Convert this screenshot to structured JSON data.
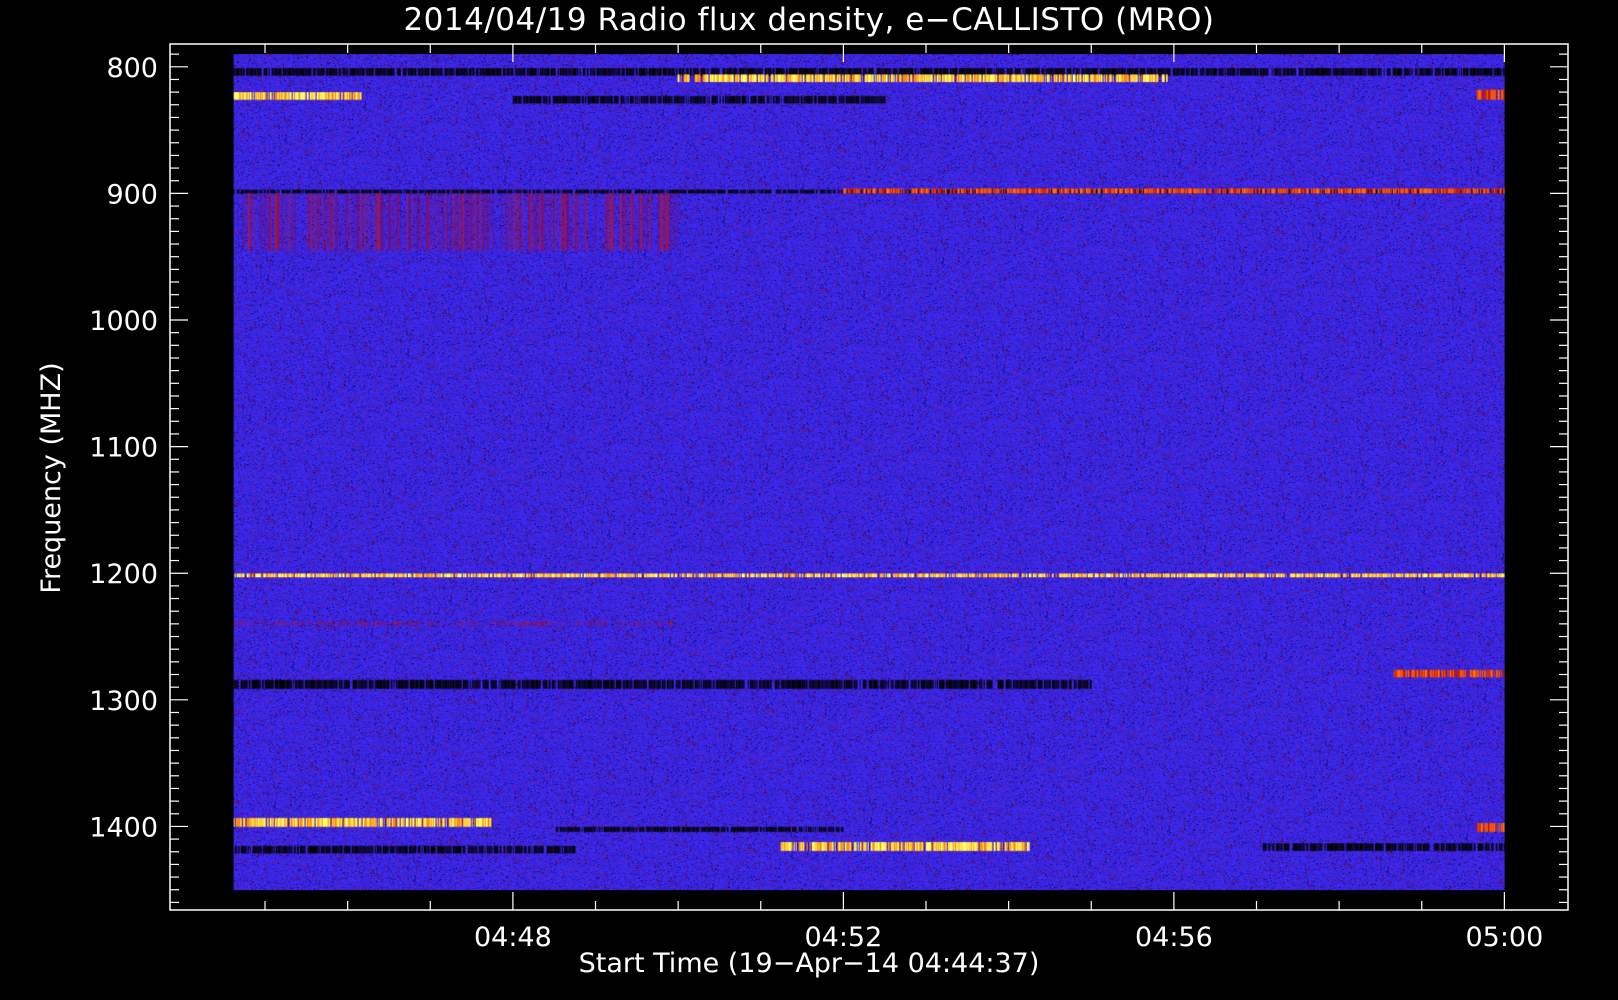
{
  "chart_data": {
    "type": "heatmap",
    "title": "2014/04/19  Radio flux density, e−CALLISTO (MRO)",
    "xlabel": "Start Time (19−Apr−14 04:44:37)",
    "ylabel": "Frequency (MHZ)",
    "x_ticks": [
      "04:48",
      "04:52",
      "04:56",
      "05:00"
    ],
    "y_ticks": [
      "800",
      "900",
      "1000",
      "1100",
      "1200",
      "1300",
      "1400"
    ],
    "x_range_minutes": [
      284.62,
      300.0
    ],
    "x_axis_range_minutes": [
      283.85,
      300.77
    ],
    "y_range_mhz": [
      790,
      1450
    ],
    "y_axis_range_mhz": [
      782,
      1466
    ],
    "y_inverted": true,
    "colormap": [
      "#000000",
      "#2a1a9a",
      "#3a22d8",
      "#8a1060",
      "#c41a10",
      "#ff8a10",
      "#ffff60"
    ],
    "background_level": "blue",
    "features": [
      {
        "freq_mhz": [
          801,
          807
        ],
        "start": "04:44:37",
        "end": "05:00",
        "level": "dark"
      },
      {
        "freq_mhz": [
          806,
          812
        ],
        "start": "04:50:00",
        "end": "04:55:55",
        "level": "bright"
      },
      {
        "freq_mhz": [
          820,
          826
        ],
        "start": "04:44:37",
        "end": "04:46:10",
        "level": "bright"
      },
      {
        "freq_mhz": [
          823,
          829
        ],
        "start": "04:48:00",
        "end": "04:52:30",
        "level": "dark"
      },
      {
        "freq_mhz": [
          818,
          826
        ],
        "start": "04:59:40",
        "end": "05:00",
        "level": "hot"
      },
      {
        "freq_mhz": [
          897,
          900
        ],
        "start": "04:44:37",
        "end": "05:00",
        "level": "dark"
      },
      {
        "freq_mhz": [
          896,
          900
        ],
        "start": "04:52:00",
        "end": "05:00",
        "level": "hot"
      },
      {
        "freq_mhz": [
          900,
          945
        ],
        "start": "04:44:37",
        "end": "04:50:00",
        "level": "warm"
      },
      {
        "freq_mhz": [
          1200,
          1203
        ],
        "start": "04:44:37",
        "end": "05:00",
        "level": "bright"
      },
      {
        "freq_mhz": [
          1238,
          1241
        ],
        "start": "04:44:37",
        "end": "04:50:00",
        "level": "warm"
      },
      {
        "freq_mhz": [
          1284,
          1291
        ],
        "start": "04:44:37",
        "end": "04:55:00",
        "level": "dark"
      },
      {
        "freq_mhz": [
          1276,
          1282
        ],
        "start": "04:58:40",
        "end": "05:00",
        "level": "hot"
      },
      {
        "freq_mhz": [
          1393,
          1400
        ],
        "start": "04:44:37",
        "end": "04:47:45",
        "level": "bright"
      },
      {
        "freq_mhz": [
          1400,
          1404
        ],
        "start": "04:48:30",
        "end": "04:52:00",
        "level": "dark"
      },
      {
        "freq_mhz": [
          1397,
          1404
        ],
        "start": "04:59:40",
        "end": "05:00",
        "level": "hot"
      },
      {
        "freq_mhz": [
          1412,
          1419
        ],
        "start": "04:51:15",
        "end": "04:54:15",
        "level": "bright"
      },
      {
        "freq_mhz": [
          1415,
          1421
        ],
        "start": "04:44:37",
        "end": "04:48:45",
        "level": "dark"
      },
      {
        "freq_mhz": [
          1413,
          1419
        ],
        "start": "04:57:05",
        "end": "05:00",
        "level": "dark"
      }
    ]
  }
}
